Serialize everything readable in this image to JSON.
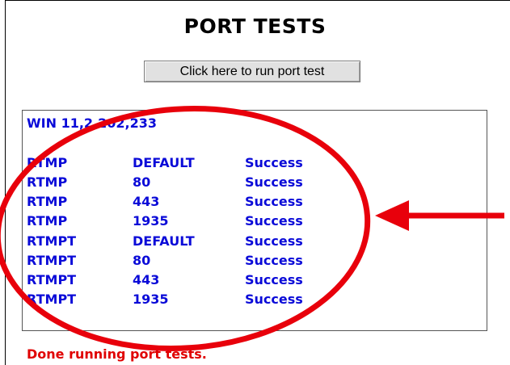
{
  "page": {
    "title": "PORT TESTS",
    "run_button_label": "Click here to run port test",
    "version": "WIN 11,2,202,233",
    "done_message": "Done running port tests."
  },
  "results": [
    {
      "protocol": "RTMP",
      "port": "DEFAULT",
      "status": "Success"
    },
    {
      "protocol": "RTMP",
      "port": "80",
      "status": "Success"
    },
    {
      "protocol": "RTMP",
      "port": "443",
      "status": "Success"
    },
    {
      "protocol": "RTMP",
      "port": "1935",
      "status": "Success"
    },
    {
      "protocol": "RTMPT",
      "port": "DEFAULT",
      "status": "Success"
    },
    {
      "protocol": "RTMPT",
      "port": "80",
      "status": "Success"
    },
    {
      "protocol": "RTMPT",
      "port": "443",
      "status": "Success"
    },
    {
      "protocol": "RTMPT",
      "port": "1935",
      "status": "Success"
    }
  ],
  "colors": {
    "result_text": "#0a0ad8",
    "done_text": "#e00000",
    "annotation": "#e8000b"
  },
  "annotations": {
    "ellipse": "annotation-ellipse",
    "arrow": "annotation-arrow-left"
  }
}
